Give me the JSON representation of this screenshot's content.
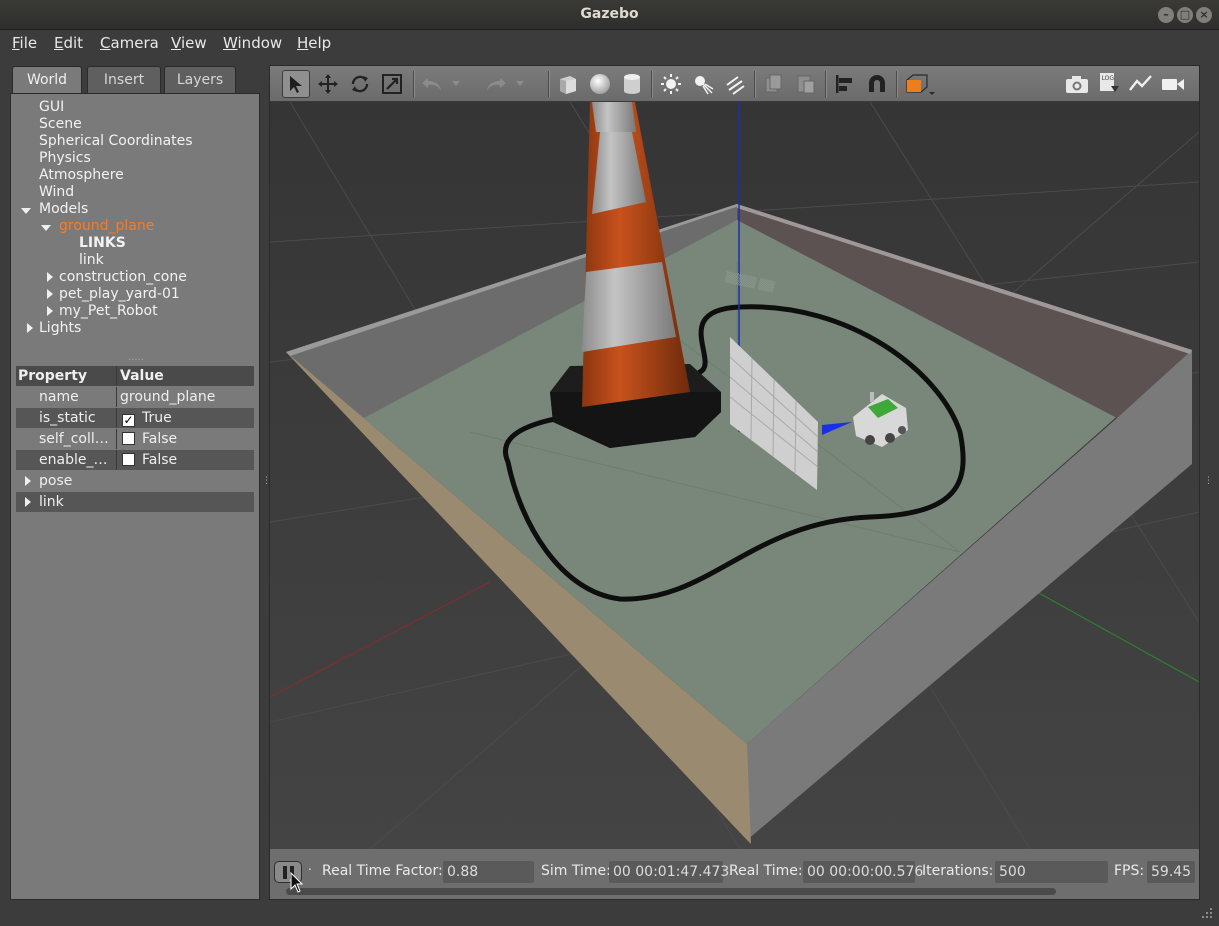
{
  "window": {
    "title": "Gazebo"
  },
  "menu": [
    "File",
    "Edit",
    "Camera",
    "View",
    "Window",
    "Help"
  ],
  "tabs": [
    "World",
    "Insert",
    "Layers"
  ],
  "tree": {
    "items": [
      "GUI",
      "Scene",
      "Spherical Coordinates",
      "Physics",
      "Atmosphere",
      "Wind"
    ],
    "models_label": "Models",
    "selected_model": "ground_plane",
    "links_header": "LINKS",
    "link_name": "link",
    "other_models": [
      "construction_cone",
      "pet_play_yard-01",
      "my_Pet_Robot"
    ],
    "lights_label": "Lights"
  },
  "properties": {
    "header_property": "Property",
    "header_value": "Value",
    "rows": [
      {
        "key": "name",
        "value": "ground_plane"
      },
      {
        "key": "is_static",
        "value": "True",
        "checked": true
      },
      {
        "key": "self_coll…",
        "value": "False",
        "checked": false
      },
      {
        "key": "enable_…",
        "value": "False",
        "checked": false
      }
    ],
    "groups": [
      "pose",
      "link"
    ]
  },
  "status": {
    "rtf_label": "Real Time Factor:",
    "rtf_value": "0.88",
    "sim_label": "Sim Time:",
    "sim_value": "00 00:01:47.473",
    "real_label": "Real Time:",
    "real_value": "00 00:00:00.576",
    "iter_label": "Iterations:",
    "iter_value": "500",
    "fps_label": "FPS:",
    "fps_value": "59.45"
  },
  "colors": {
    "selected": "#ff7a1a",
    "panel_bg": "#7a7a7a",
    "floor": "#78877a",
    "cone_orange": "#b8471a"
  }
}
